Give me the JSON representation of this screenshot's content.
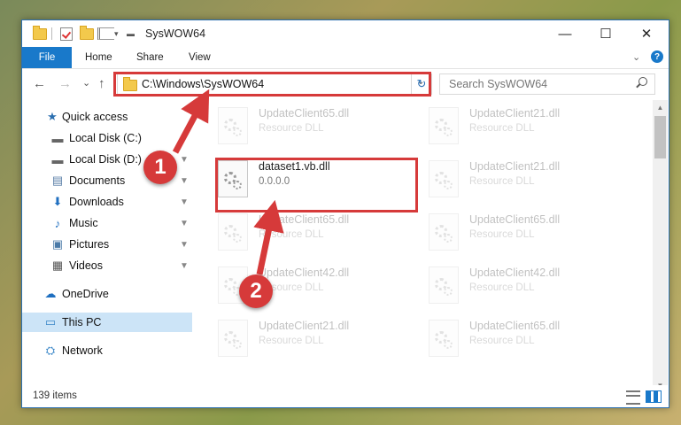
{
  "window": {
    "title": "SysWOW64",
    "controls": {
      "minimize": "—",
      "maximize": "☐",
      "close": "✕"
    }
  },
  "ribbon": {
    "tabs": [
      "File",
      "Home",
      "Share",
      "View"
    ],
    "help": "?"
  },
  "nav": {
    "back": "←",
    "forward": "→",
    "recent": "⌄",
    "up": "↑"
  },
  "address": {
    "path": "C:\\Windows\\SysWOW64",
    "dropdown": "⌄",
    "refresh": "↻"
  },
  "search": {
    "placeholder": "Search SysWOW64"
  },
  "sidebar": {
    "items": [
      {
        "label": "Quick access",
        "icon": "star-icon",
        "glyph": "★",
        "color": "#2b6fb0"
      },
      {
        "label": "Local Disk (C:)",
        "icon": "drive-icon",
        "glyph": "▬",
        "color": "#666"
      },
      {
        "label": "Local Disk (D:)",
        "icon": "drive-icon",
        "glyph": "▬",
        "color": "#666"
      },
      {
        "label": "Documents",
        "icon": "documents-icon",
        "glyph": "▤",
        "color": "#5a7fa8"
      },
      {
        "label": "Downloads",
        "icon": "downloads-icon",
        "glyph": "⬇",
        "color": "#1f6fc0"
      },
      {
        "label": "Music",
        "icon": "music-icon",
        "glyph": "♪",
        "color": "#1f6fc0"
      },
      {
        "label": "Pictures",
        "icon": "pictures-icon",
        "glyph": "▣",
        "color": "#4a7aa8"
      },
      {
        "label": "Videos",
        "icon": "videos-icon",
        "glyph": "▦",
        "color": "#555"
      },
      {
        "label": "OneDrive",
        "icon": "onedrive-icon",
        "glyph": "☁",
        "color": "#1f6fc0"
      },
      {
        "label": "This PC",
        "icon": "computer-icon",
        "glyph": "▭",
        "color": "#3a87c8"
      },
      {
        "label": "Network",
        "icon": "network-icon",
        "glyph": "⛭",
        "color": "#3a87c8"
      }
    ],
    "pin": "📌"
  },
  "files": [
    {
      "name": "UpdateClient65.dll",
      "type": "Resource DLL"
    },
    {
      "name": "UpdateClient21.dll",
      "type": "Resource DLL"
    },
    {
      "name": "dataset1.vb.dll",
      "type": "0.0.0.0"
    },
    {
      "name": "UpdateClient21.dll",
      "type": "Resource DLL"
    },
    {
      "name": "UpdateClient65.dll",
      "type": "Resource DLL"
    },
    {
      "name": "UpdateClient65.dll",
      "type": "Resource DLL"
    },
    {
      "name": "UpdateClient42.dll",
      "type": "Resource DLL"
    },
    {
      "name": "UpdateClient42.dll",
      "type": "Resource DLL"
    },
    {
      "name": "UpdateClient21.dll",
      "type": "Resource DLL"
    },
    {
      "name": "UpdateClient65.dll",
      "type": "Resource DLL"
    }
  ],
  "status": {
    "item_count": "139 items"
  },
  "annotations": {
    "step1": "1",
    "step2": "2",
    "color": "#d63a3a"
  }
}
